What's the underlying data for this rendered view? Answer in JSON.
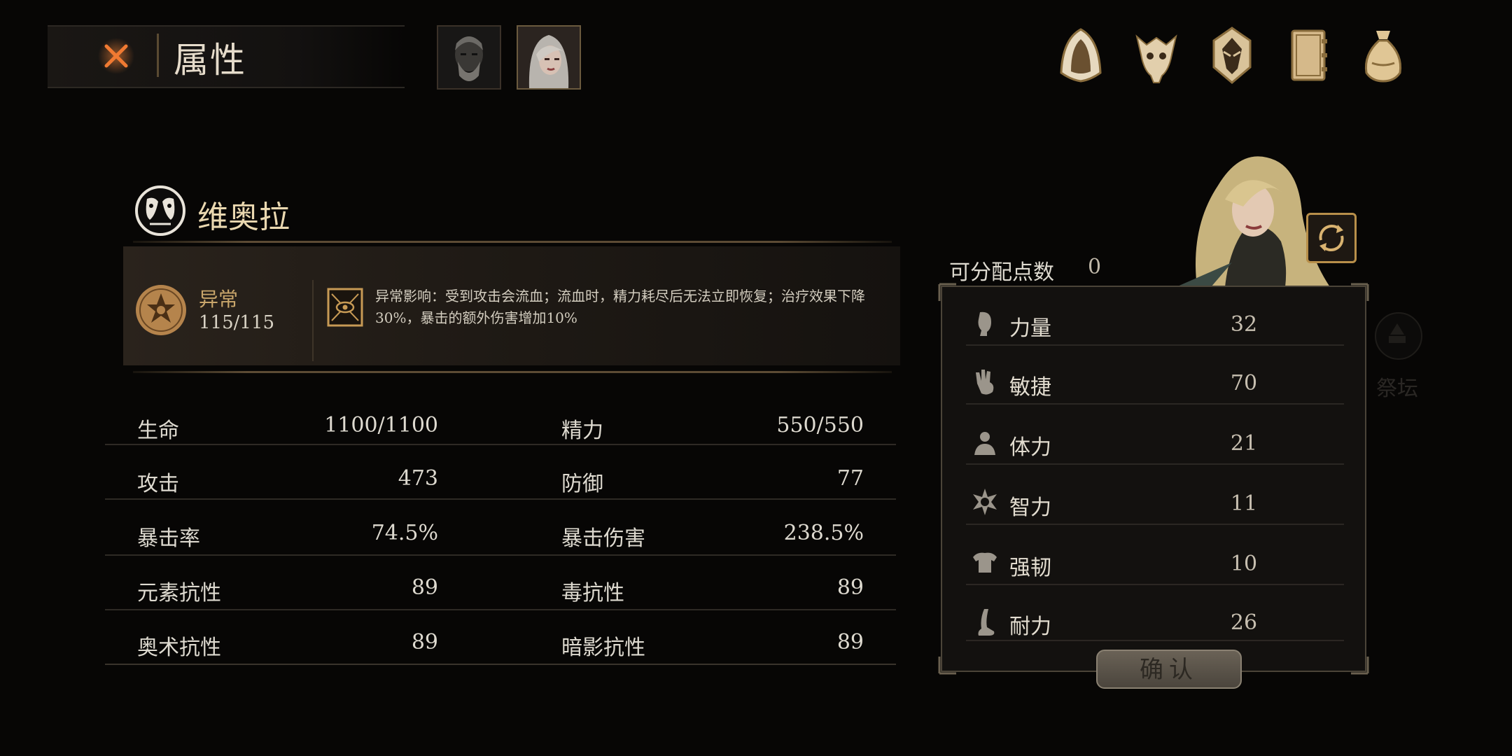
{
  "header": {
    "title": "属性",
    "close_icon": "close-x-icon",
    "top_icons": [
      "hood-icon",
      "beast-skull-icon",
      "tribal-mask-icon",
      "journal-icon",
      "coin-bag-icon"
    ]
  },
  "character": {
    "name": "维奥拉",
    "emblem_icon": "twin-masks-emblem-icon"
  },
  "abnormal": {
    "label": "异常",
    "value": "115/115",
    "icon": "bleed-sigil-icon",
    "effect_icon": "eye-sigil-icon",
    "description": "异常影响：受到攻击会流血；流血时，精力耗尽后无法立即恢复；治疗效果下降30%，暴击的额外伤害增加10%"
  },
  "stats": [
    {
      "left_label": "生命",
      "left_value": "1100/1100",
      "right_label": "精力",
      "right_value": "550/550"
    },
    {
      "left_label": "攻击",
      "left_value": "473",
      "right_label": "防御",
      "right_value": "77"
    },
    {
      "left_label": "暴击率",
      "left_value": "74.5%",
      "right_label": "暴击伤害",
      "right_value": "238.5%"
    },
    {
      "left_label": "元素抗性",
      "left_value": "89",
      "right_label": "毒抗性",
      "right_value": "89"
    },
    {
      "left_label": "奥术抗性",
      "left_value": "89",
      "right_label": "暗影抗性",
      "right_value": "89"
    }
  ],
  "allocation": {
    "points_label": "可分配点数",
    "points_value": "0",
    "attributes": [
      {
        "label": "力量",
        "value": "32",
        "icon": "strength-head-icon"
      },
      {
        "label": "敏捷",
        "value": "70",
        "icon": "agility-hand-icon"
      },
      {
        "label": "体力",
        "value": "21",
        "icon": "vitality-body-icon"
      },
      {
        "label": "智力",
        "value": "11",
        "icon": "intellect-burst-icon"
      },
      {
        "label": "强韧",
        "value": "10",
        "icon": "toughness-torso-icon"
      },
      {
        "label": "耐力",
        "value": "26",
        "icon": "endurance-leg-icon"
      }
    ],
    "confirm_label": "确认"
  },
  "side": {
    "altar_label": "祭坛"
  },
  "colors": {
    "background": "#070605",
    "gold_accent": "#c9a66b",
    "panel_border": "#4b4438",
    "close_orange": "#e0662a"
  }
}
